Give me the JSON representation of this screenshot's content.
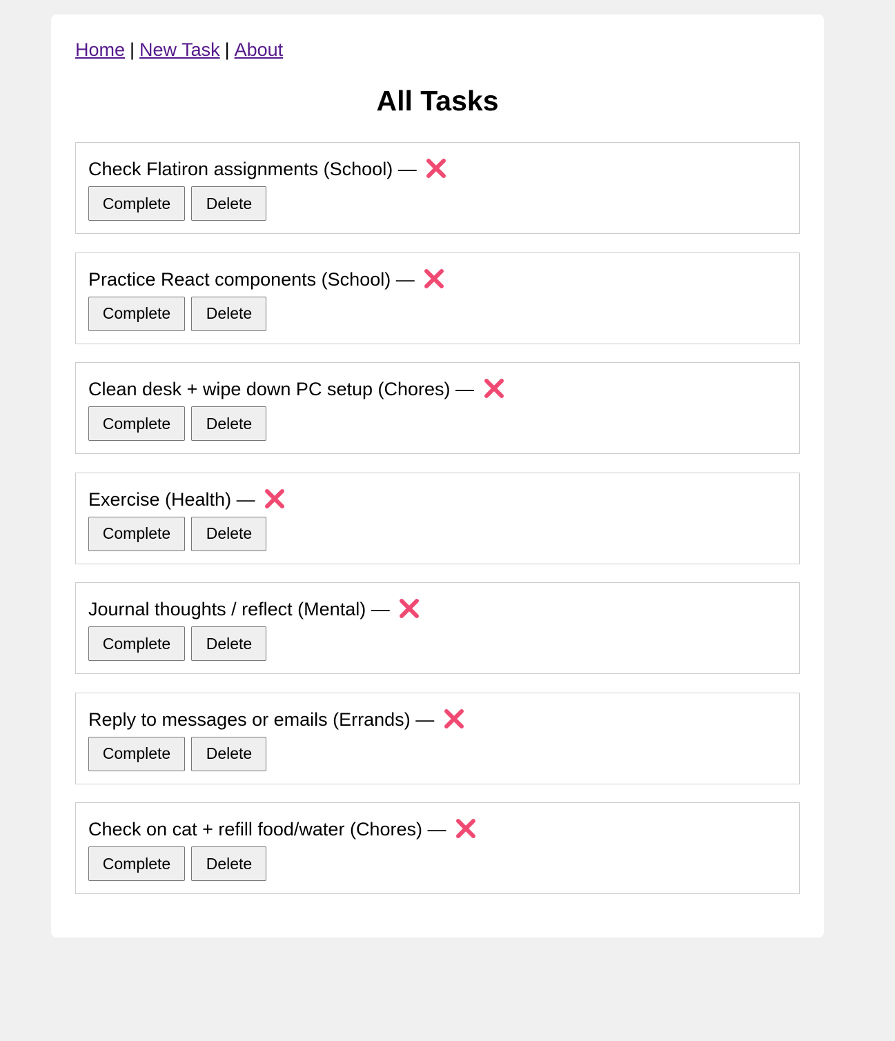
{
  "nav": {
    "links": [
      "Home",
      "New Task",
      "About"
    ],
    "separator": "|"
  },
  "page": {
    "title": "All Tasks"
  },
  "tasks": [
    {
      "title": "Check Flatiron assignments",
      "category": "School",
      "dash": "—",
      "status_icon": "cross-mark-icon"
    },
    {
      "title": "Practice React components",
      "category": "School",
      "dash": "—",
      "status_icon": "cross-mark-icon"
    },
    {
      "title": "Clean desk + wipe down PC setup",
      "category": "Chores",
      "dash": "—",
      "status_icon": "cross-mark-icon"
    },
    {
      "title": "Exercise",
      "category": "Health",
      "dash": "—",
      "status_icon": "cross-mark-icon"
    },
    {
      "title": "Journal thoughts / reflect",
      "category": "Mental",
      "dash": "—",
      "status_icon": "cross-mark-icon"
    },
    {
      "title": "Reply to messages or emails",
      "category": "Errands",
      "dash": "—",
      "status_icon": "cross-mark-icon"
    },
    {
      "title": "Check on cat + refill food/water",
      "category": "Chores",
      "dash": "—",
      "status_icon": "cross-mark-icon"
    }
  ],
  "buttons": {
    "complete_label": "Complete",
    "delete_label": "Delete"
  },
  "colors": {
    "page_background": "#f0f0f0",
    "card_background": "#ffffff",
    "link": "#551a8b",
    "cross_mark": "#f04a72"
  }
}
